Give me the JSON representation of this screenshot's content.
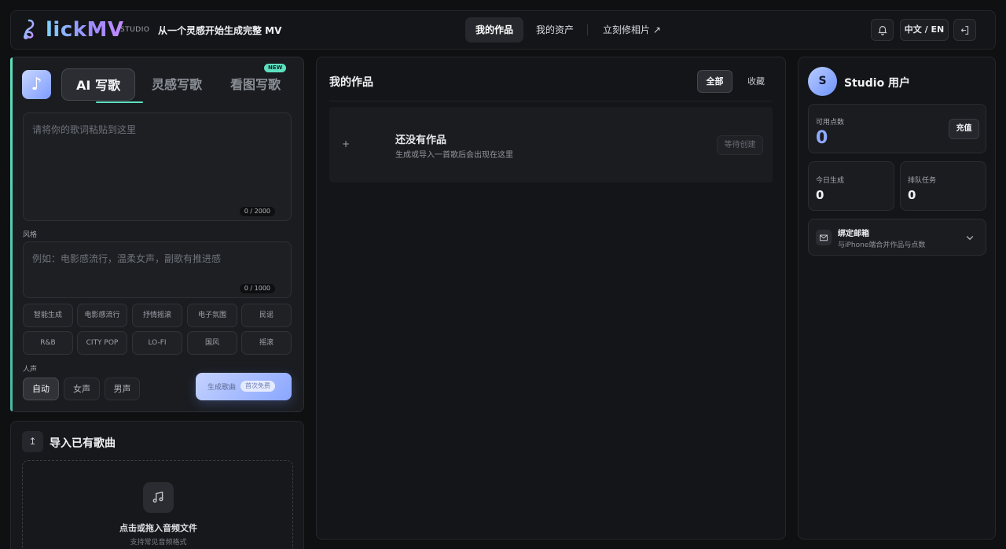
{
  "header": {
    "logo_text": "lickMV",
    "logo_sub": "STUDIO",
    "slogan": "从一个灵感开始生成完整 MV",
    "nav": [
      "我的作品",
      "我的资产",
      "立刻修相片 ↗"
    ],
    "lang": "中文 / EN",
    "bell_icon": "bell-icon",
    "logout_icon": "logout-icon"
  },
  "compose": {
    "tabs": [
      "AI 写歌",
      "灵感写歌",
      "看图写歌"
    ],
    "new_badge": "NEW",
    "lyrics_placeholder": "请将你的歌词粘贴到这里",
    "lyrics_counter": "0 / 2000",
    "style_label": "风格",
    "style_placeholder": "例如：电影感流行，温柔女声，副歌有推进感",
    "style_counter": "0 / 1000",
    "style_chips": [
      "智能生成",
      "电影感流行",
      "抒情摇滚",
      "电子氛围",
      "民谣",
      "R&B",
      "CITY POP",
      "LO-FI",
      "国风",
      "摇滚"
    ],
    "voice_label": "人声",
    "voice_options": [
      "自动",
      "女声",
      "男声"
    ],
    "generate_label": "生成歌曲",
    "generate_badge": "首次免费"
  },
  "import": {
    "title": "导入已有歌曲",
    "drop_title": "点击或拖入音频文件",
    "drop_hint": "支持常见音频格式"
  },
  "works": {
    "title": "我的作品",
    "filters": [
      "全部",
      "收藏"
    ],
    "empty_title": "还没有作品",
    "empty_desc": "生成或导入一首歌后会出现在这里",
    "empty_status": "等待创建",
    "plus": "+"
  },
  "user": {
    "avatar_letter": "S",
    "name": "Studio 用户",
    "points_label": "可用点数",
    "points_value": "0",
    "recharge": "充值",
    "today_label": "今日生成",
    "today_value": "0",
    "queue_label": "排队任务",
    "queue_value": "0",
    "bind_title": "绑定邮箱",
    "bind_desc": "与iPhone端合并作品与点数"
  },
  "colors": {
    "accent": "#5ee0c0",
    "primary": "#8aa6ff",
    "background": "#0f1012"
  }
}
